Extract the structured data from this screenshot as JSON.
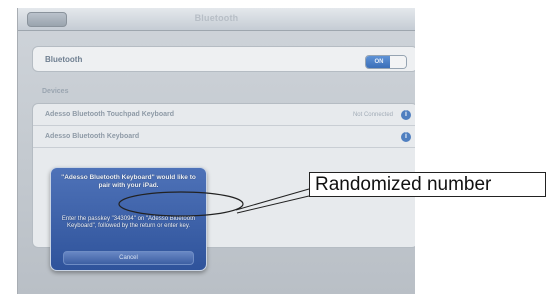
{
  "navbar": {
    "title": "Bluetooth"
  },
  "bluetooth": {
    "label": "Bluetooth",
    "toggle": "ON"
  },
  "devices": {
    "section_label": "Devices",
    "items": [
      {
        "name": "Adesso Bluetooth Touchpad Keyboard",
        "status": "Not Connected"
      },
      {
        "name": "Adesso Bluetooth Keyboard",
        "status": ""
      }
    ]
  },
  "alert": {
    "title": "\"Adesso Bluetooth Keyboard\" would like to pair with your iPad.",
    "message": "Enter the passkey \"343094\" on \"Adesso Bluetooth Keyboard\", followed by the return or enter key.",
    "cancel": "Cancel"
  },
  "annotation": {
    "label": "Randomized number"
  },
  "colors": {
    "alert": "#3a5fa8",
    "toggle_on": "#4a7fcc",
    "accent": "#4f7fc0"
  },
  "icons": {
    "info": "info-circle-icon",
    "back": "back-arrow-icon"
  }
}
